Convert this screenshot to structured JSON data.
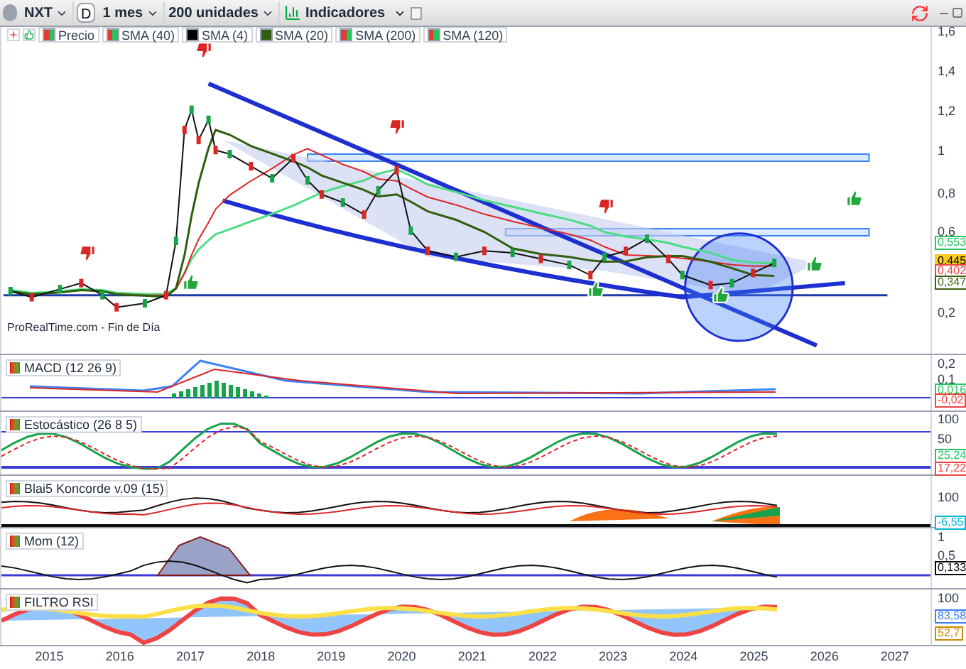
{
  "toolbar": {
    "symbol": "NXT",
    "mode": "D",
    "period": "1 mes",
    "units": "200 unidades",
    "indicators": "Indicadores"
  },
  "legend": [
    {
      "label": "Precio",
      "kind": "split",
      "color": "#22c55e"
    },
    {
      "label": "SMA (40)",
      "kind": "split",
      "color": "#22c55e"
    },
    {
      "label": "SMA (4)",
      "kind": "solid",
      "color": "#000000"
    },
    {
      "label": "SMA (20)",
      "kind": "solid",
      "color": "#2f5e0e"
    },
    {
      "label": "SMA (200)",
      "kind": "split",
      "color": "#22c55e"
    },
    {
      "label": "SMA (120)",
      "kind": "split",
      "color": "#22c55e"
    }
  ],
  "main_chart": {
    "source": "ProRealTime.com - Fin de Día",
    "y_ticks": [
      "1,6",
      "1,4",
      "1,2",
      "1",
      "0,8",
      "0,6",
      "0,2"
    ],
    "price_tags": [
      {
        "text": "0,553",
        "kind": "outline",
        "color": "#22c55e"
      },
      {
        "text": "0,445",
        "kind": "filled",
        "color": "#facc15"
      },
      {
        "text": "0,402",
        "kind": "outline",
        "color": "#ef4444"
      },
      {
        "text": "0,347",
        "kind": "outline",
        "color": "#3f6212"
      }
    ]
  },
  "panels": [
    {
      "title": "MACD (12 26 9)",
      "kind": "macd",
      "ticks": [
        "0,2",
        "0,1"
      ],
      "tags": [
        {
          "text": "0,016",
          "color": "#22c55e"
        },
        {
          "text": "-0,02",
          "color": "#ef4444"
        }
      ]
    },
    {
      "title": "Estocástico (26 8 5)",
      "kind": "stochastic",
      "ticks": [
        "100",
        "50"
      ],
      "tags": [
        {
          "text": "25,24",
          "color": "#22c55e"
        },
        {
          "text": "17,22",
          "color": "#ef4444"
        }
      ]
    },
    {
      "title": "Blai5 Koncorde v.09 (15)",
      "kind": "koncorde",
      "ticks": [
        "100"
      ],
      "tags": [
        {
          "text": "-6,55",
          "color": "#06b6d4"
        }
      ]
    },
    {
      "title": "Mom (12)",
      "kind": "momentum",
      "ticks": [
        "1",
        "0,5"
      ],
      "tags": [
        {
          "text": "0,133",
          "color": "#000000"
        }
      ]
    },
    {
      "title": "FILTRO RSI",
      "kind": "rsi",
      "ticks": [
        "100"
      ],
      "tags": [
        {
          "text": "83,58",
          "color": "#3b82f6"
        },
        {
          "text": "52,7",
          "color": "#ca8a04"
        }
      ]
    }
  ],
  "x_axis": [
    "2015",
    "2016",
    "2017",
    "2018",
    "2019",
    "2020",
    "2021",
    "2022",
    "2023",
    "2024",
    "2025",
    "2026",
    "2027"
  ]
}
